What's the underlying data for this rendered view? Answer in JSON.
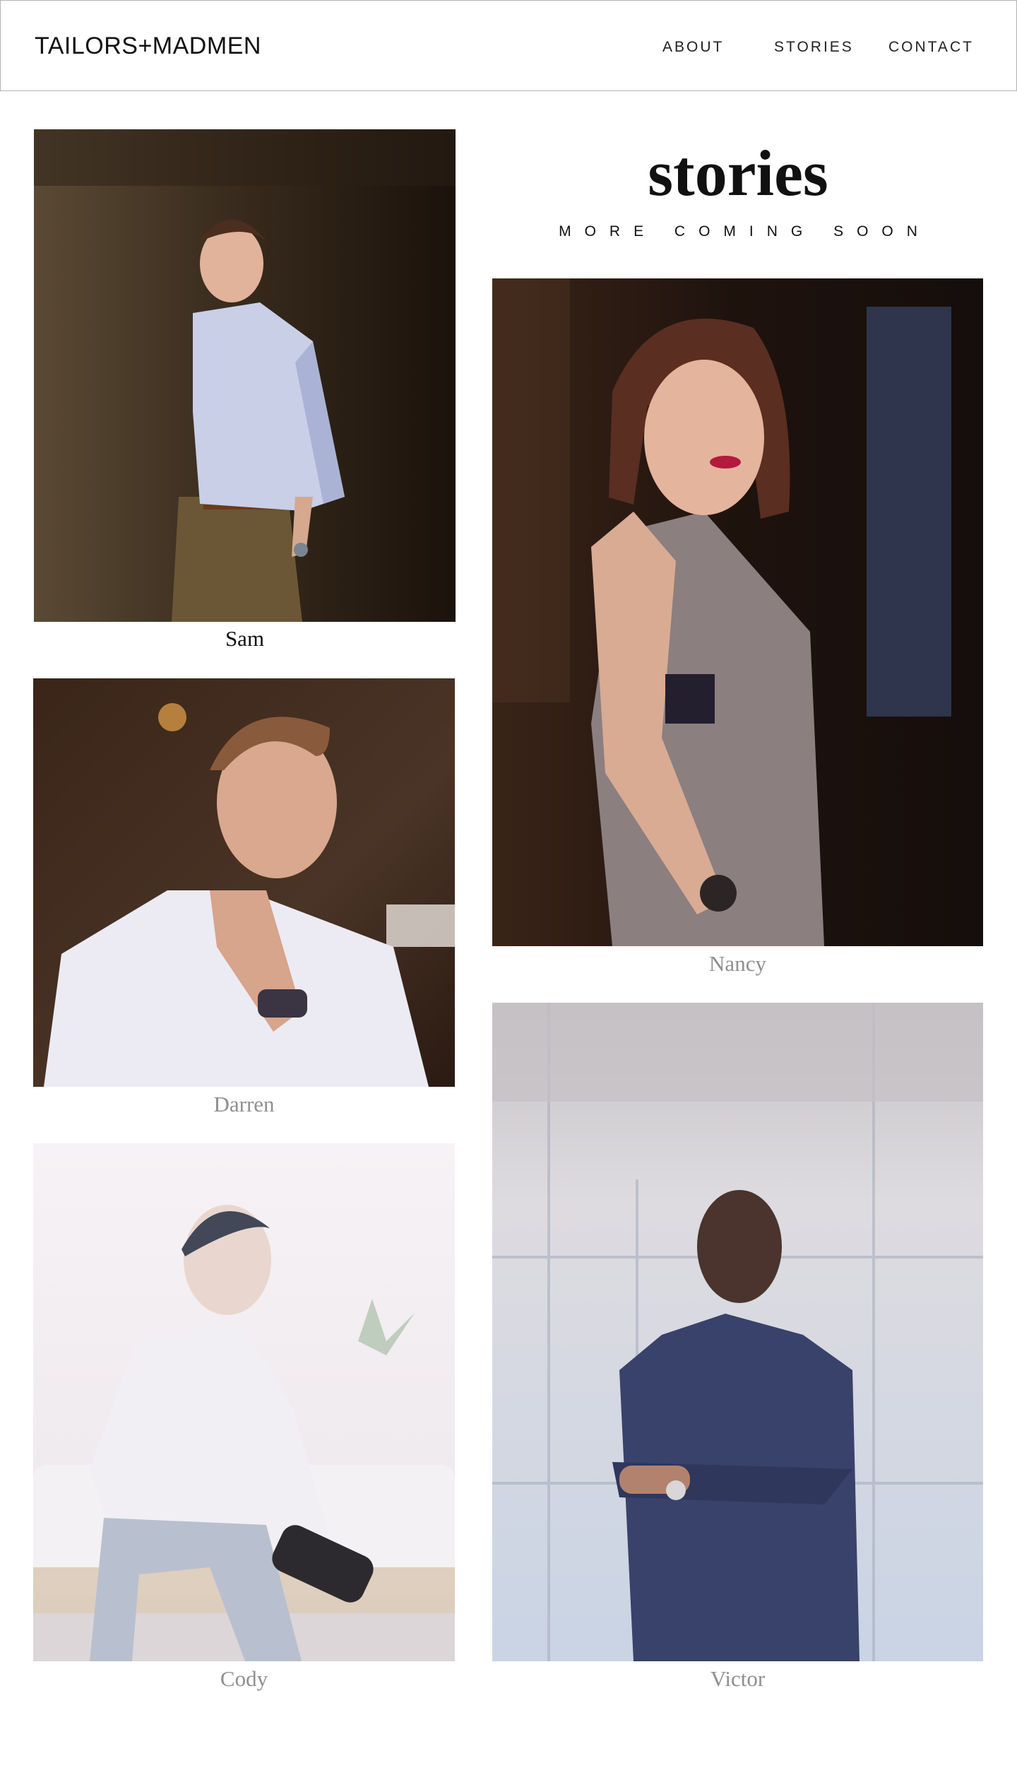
{
  "header": {
    "logo": "TAILORS+MADMEN",
    "nav": [
      "ABOUT",
      "STORIES",
      "CONTACT"
    ]
  },
  "page": {
    "title": "stories",
    "subtitle": "MORE COMING SOON"
  },
  "stories": {
    "sam": "Sam",
    "darren": "Darren",
    "cody": "Cody",
    "nancy": "Nancy",
    "victor": "Victor"
  },
  "colors": {
    "text": "#111111",
    "caption_muted": "#8f8f8f",
    "header_border": "#b3b3b3"
  }
}
